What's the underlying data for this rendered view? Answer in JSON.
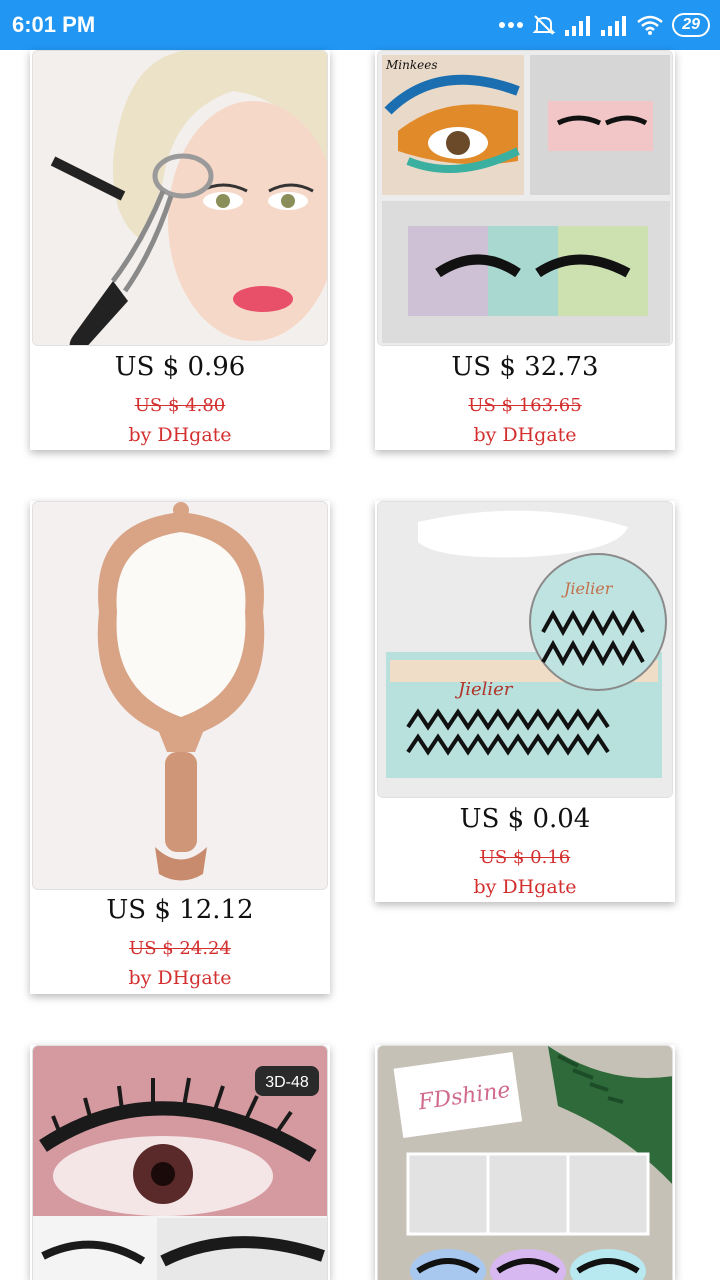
{
  "status_bar": {
    "time": "6:01 PM",
    "battery": "29",
    "icons": [
      "more-dots-icon",
      "alarm-off-icon",
      "signal-icon",
      "signal-icon",
      "wifi-icon",
      "battery-icon"
    ]
  },
  "colors": {
    "status_bar": "#2196f3",
    "accent_red": "#d32f2f"
  },
  "products": [
    {
      "price": "US $ 0.96",
      "old_price": "US $ 4.80",
      "seller": "by DHgate",
      "image": "eyelash-curler-model-photo"
    },
    {
      "price": "US $ 32.73",
      "old_price": "US $ 163.65",
      "seller": "by DHgate",
      "image": "minkees-lashes-box-photo"
    },
    {
      "price": "US $ 12.12",
      "old_price": "US $ 24.24",
      "seller": "by DHgate",
      "image": "rose-gold-hand-mirror-photo"
    },
    {
      "price": "US $ 0.04",
      "old_price": "US $ 0.16",
      "seller": "by DHgate",
      "image": "jielier-lash-clusters-photo"
    },
    {
      "image": "3d-lashes-eye-photo",
      "badge": "3D-48"
    },
    {
      "image": "fdshine-lash-cases-photo",
      "brand": "FDshine"
    }
  ],
  "image_text": {
    "minkees": "Minkees",
    "jielier": "Jielier"
  }
}
